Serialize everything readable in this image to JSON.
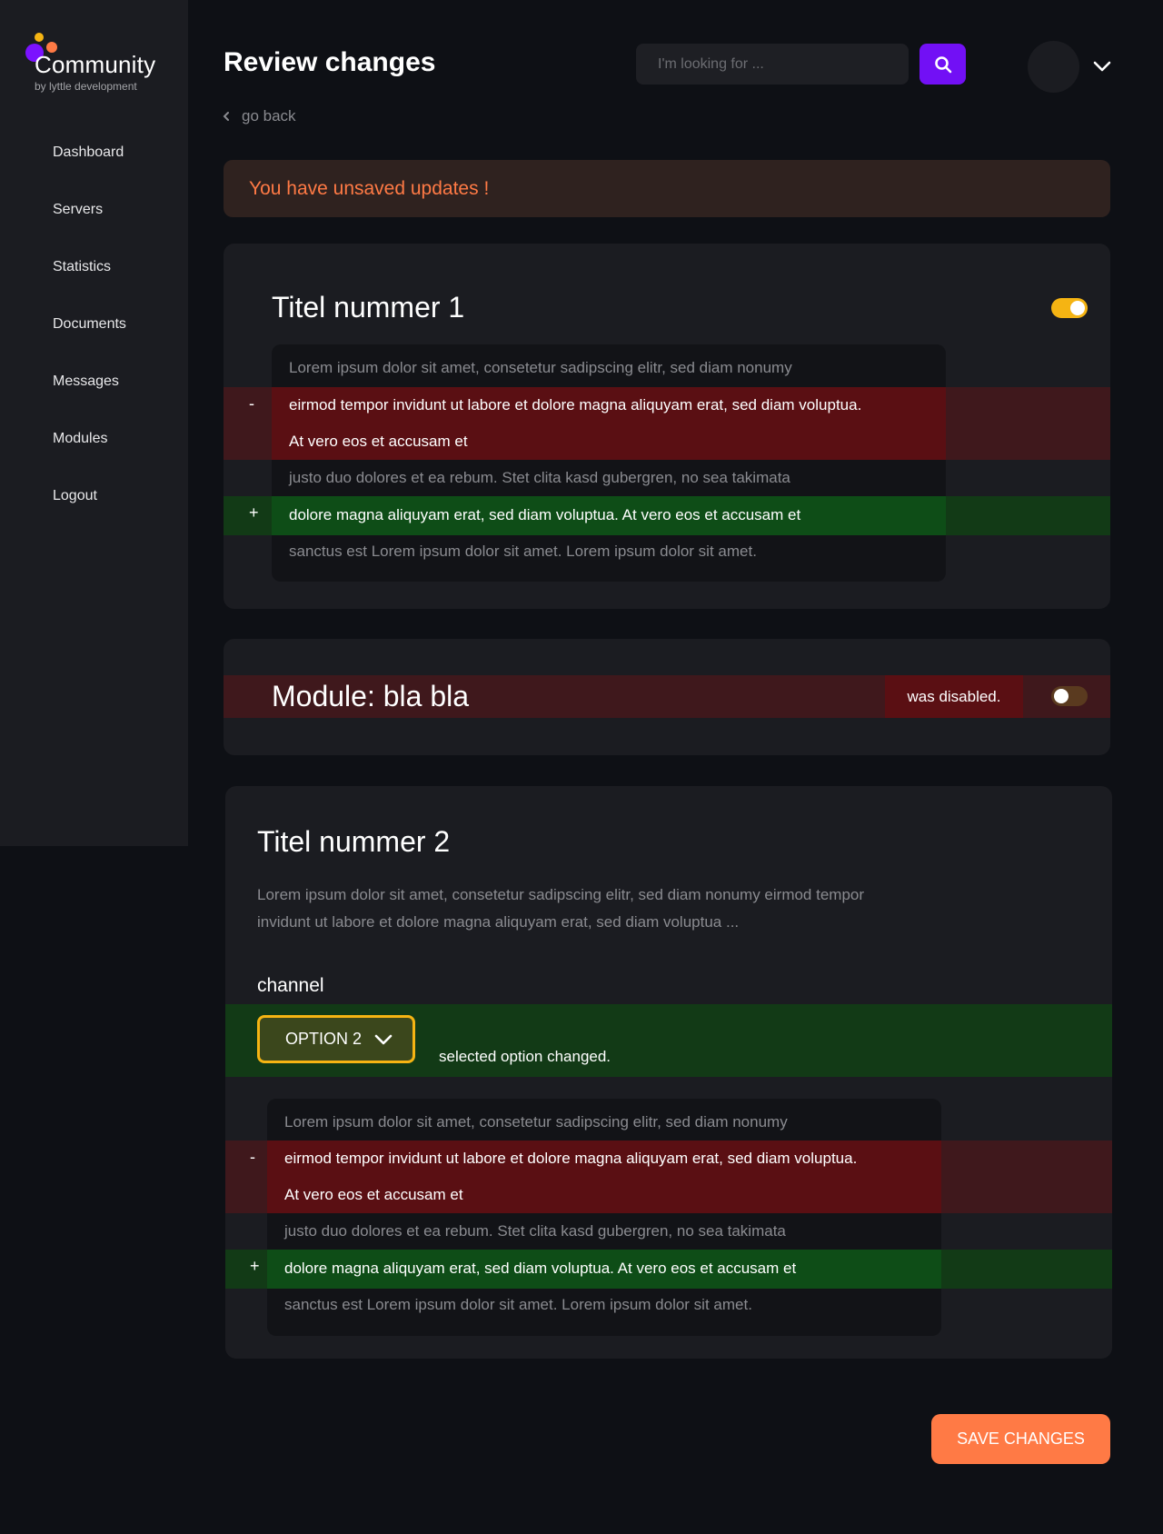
{
  "brand": {
    "title": "Community",
    "subtitle": "by lyttle development"
  },
  "sidebar": {
    "items": [
      {
        "label": "Dashboard"
      },
      {
        "label": "Servers"
      },
      {
        "label": "Statistics"
      },
      {
        "label": "Documents"
      },
      {
        "label": "Messages"
      },
      {
        "label": "Modules"
      },
      {
        "label": "Logout"
      }
    ]
  },
  "header": {
    "title": "Review changes",
    "search_placeholder": "I'm looking for ...",
    "search_icon": "search-icon",
    "user_menu_icon": "chevron-down-icon"
  },
  "go_back": {
    "label": "go back",
    "icon": "chevron-left-icon"
  },
  "alert": {
    "text": "You have unsaved updates !"
  },
  "card1": {
    "title": "Titel nummer 1",
    "toggle_on": true,
    "diff": {
      "line1": "Lorem ipsum dolor sit amet, consetetur sadipscing elitr, sed diam nonumy",
      "removed_marker": "-",
      "removed_line1": "eirmod tempor invidunt ut labore et dolore magna aliquyam erat, sed diam voluptua.",
      "removed_line2": "At vero eos et accusam et",
      "line2": " justo duo dolores et ea rebum. Stet clita kasd gubergren, no sea takimata",
      "added_marker": "+",
      "added_line": "dolore magna aliquyam erat, sed diam voluptua. At vero eos et accusam et",
      "line3": "sanctus est Lorem ipsum dolor sit amet. Lorem ipsum dolor sit amet."
    }
  },
  "card2": {
    "title": "Module: bla bla",
    "status": "was disabled.",
    "toggle_on": false
  },
  "card3": {
    "title": "Titel nummer 2",
    "description": "Lorem ipsum dolor sit amet, consetetur sadipscing elitr, sed diam nonumy eirmod tempor invidunt ut labore et dolore magna aliquyam erat, sed diam voluptua ...",
    "field_label": "channel",
    "select_value": "OPTION 2",
    "select_note": "selected option changed.",
    "diff": {
      "line1": "Lorem ipsum dolor sit amet, consetetur sadipscing elitr, sed diam nonumy",
      "removed_marker": "-",
      "removed_line1": "eirmod tempor invidunt ut labore et dolore magna aliquyam erat, sed diam voluptua.",
      "removed_line2": "At vero eos et accusam et",
      "line2": " justo duo dolores et ea rebum. Stet clita kasd gubergren, no sea takimata",
      "added_marker": "+",
      "added_line": "dolore magna aliquyam erat, sed diam voluptua. At vero eos et accusam et",
      "line3": "sanctus est Lorem ipsum dolor sit amet. Lorem ipsum dolor sit amet."
    }
  },
  "footer": {
    "save_label": "SAVE CHANGES"
  },
  "colors": {
    "accent_purple": "#7210f5",
    "accent_orange": "#ff7a45",
    "accent_yellow": "#f5b413",
    "removed_red": "#5a0f13",
    "added_green": "#0e4d17"
  }
}
